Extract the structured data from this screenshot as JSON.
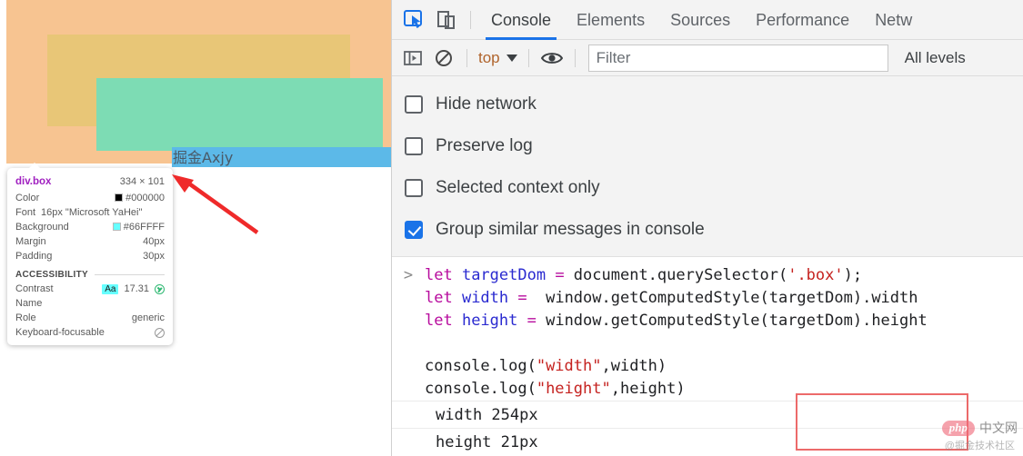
{
  "page": {
    "inner_text": "掘金Axjy",
    "overlay": {
      "margin_color": "#f7c491",
      "padding_color": "#e8c677",
      "content_color": "#7ddcb4",
      "inner_color": "#5cb9e8"
    }
  },
  "tooltip": {
    "selector": "div.box",
    "dimensions": "334 × 101",
    "rows": [
      {
        "key": "Color",
        "value": "#000000",
        "swatch": "#000000"
      },
      {
        "key": "Background",
        "value": "#66FFFF",
        "swatch": "#66FFFF"
      },
      {
        "key": "Margin",
        "value": "40px"
      },
      {
        "key": "Padding",
        "value": "30px"
      }
    ],
    "font_key": "Font",
    "font_value": "16px \"Microsoft YaHei\"",
    "accessibility": {
      "heading": "ACCESSIBILITY",
      "contrast_key": "Contrast",
      "contrast_chip": "Aa",
      "contrast_value": "17.31",
      "name_key": "Name",
      "name_value": "",
      "role_key": "Role",
      "role_value": "generic",
      "focusable_key": "Keyboard-focusable",
      "focusable_value": ""
    }
  },
  "devtools": {
    "tabs": [
      {
        "label": "Console",
        "active": true
      },
      {
        "label": "Elements",
        "active": false
      },
      {
        "label": "Sources",
        "active": false
      },
      {
        "label": "Performance",
        "active": false
      },
      {
        "label": "Netw",
        "active": false
      }
    ],
    "icons": {
      "inspect": "inspect-element-icon",
      "device": "device-toolbar-icon",
      "sidebar": "console-sidebar-icon",
      "clear": "clear-console-icon",
      "eye": "live-expression-icon"
    },
    "filterbar": {
      "context": "top",
      "filter_placeholder": "Filter",
      "filter_value": "",
      "levels": "All levels"
    },
    "settings": [
      {
        "label": "Hide network",
        "checked": false
      },
      {
        "label": "Preserve log",
        "checked": false
      },
      {
        "label": "Selected context only",
        "checked": false
      },
      {
        "label": "Group similar messages in console",
        "checked": true
      }
    ],
    "console": {
      "prompt": ">",
      "code_lines": [
        [
          {
            "t": "let ",
            "c": "k-let"
          },
          {
            "t": "targetDom",
            "c": "k-var"
          },
          {
            "t": " = ",
            "c": "k-eq"
          },
          {
            "t": "document.querySelector(",
            "c": "k-plain"
          },
          {
            "t": "'.box'",
            "c": "k-str"
          },
          {
            "t": ");",
            "c": "k-plain"
          }
        ],
        [
          {
            "t": "let ",
            "c": "k-let"
          },
          {
            "t": "width",
            "c": "k-var"
          },
          {
            "t": " = ",
            "c": "k-eq"
          },
          {
            "t": " window.getComputedStyle(targetDom).width",
            "c": "k-plain"
          }
        ],
        [
          {
            "t": "let ",
            "c": "k-let"
          },
          {
            "t": "height",
            "c": "k-var"
          },
          {
            "t": " = ",
            "c": "k-eq"
          },
          {
            "t": "window.getComputedStyle(targetDom).height",
            "c": "k-plain"
          }
        ],
        [],
        [
          {
            "t": "console.log(",
            "c": "k-plain"
          },
          {
            "t": "\"width\"",
            "c": "k-str"
          },
          {
            "t": ",width)",
            "c": "k-plain"
          }
        ],
        [
          {
            "t": "console.log(",
            "c": "k-plain"
          },
          {
            "t": "\"height\"",
            "c": "k-str"
          },
          {
            "t": ",height)",
            "c": "k-plain"
          }
        ]
      ],
      "outputs": [
        "width 254px",
        "height 21px"
      ],
      "highlight_color": "#ec6a6a"
    }
  },
  "watermark": {
    "badge": "php",
    "site": "中文网",
    "source": "@掘金技术社区"
  }
}
